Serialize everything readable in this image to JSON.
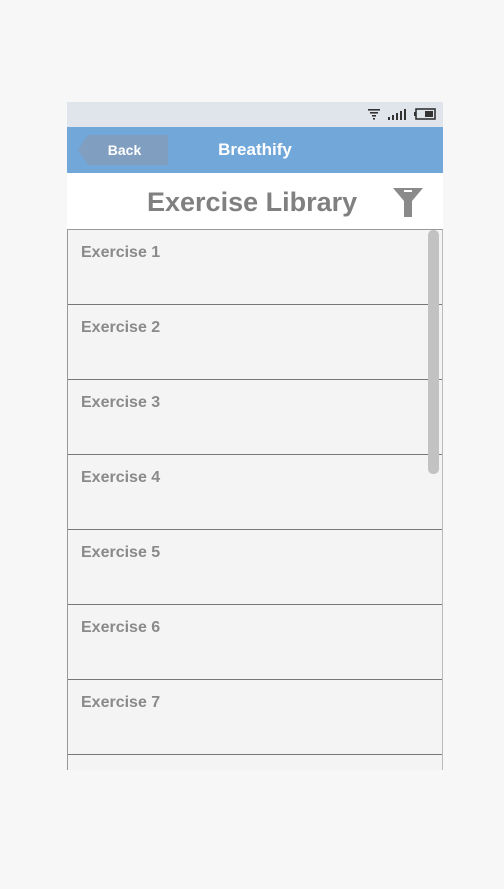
{
  "nav": {
    "back_label": "Back",
    "app_title": "Breathify"
  },
  "header": {
    "title": "Exercise Library",
    "filter_icon": "filter-icon"
  },
  "status_bar": {
    "icons": [
      "wifi-icon",
      "signal-icon",
      "battery-icon"
    ]
  },
  "colors": {
    "nav_bar": "#72a8d9",
    "back_button": "#7f9ec0",
    "status_bar": "#dfe5ea",
    "list_background": "#f4f4f4",
    "label_text": "#8a8a8a"
  },
  "exercises": [
    {
      "label": "Exercise 1"
    },
    {
      "label": "Exercise 2"
    },
    {
      "label": "Exercise 3"
    },
    {
      "label": "Exercise 4"
    },
    {
      "label": "Exercise 5"
    },
    {
      "label": "Exercise 6"
    },
    {
      "label": "Exercise 7"
    },
    {
      "label": ""
    }
  ]
}
